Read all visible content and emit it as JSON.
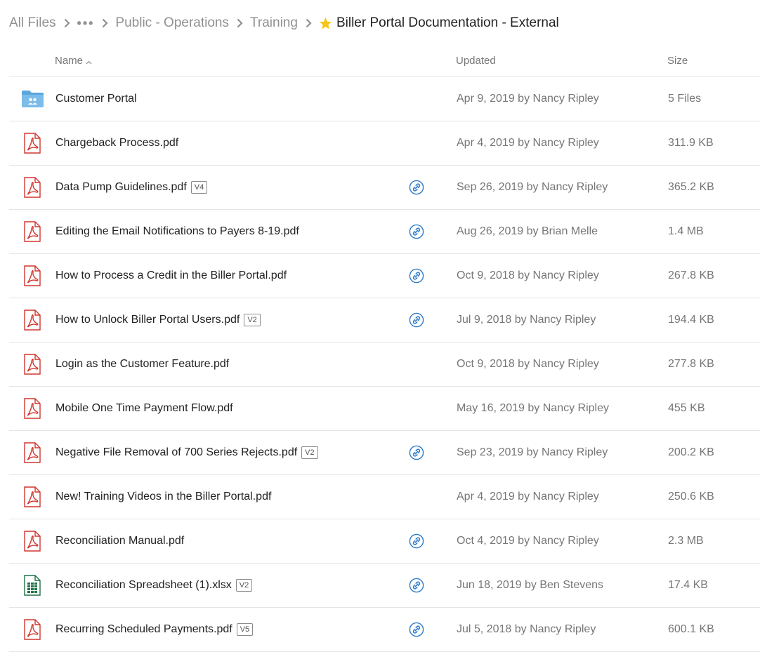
{
  "breadcrumb": {
    "items": [
      "All Files",
      "Public - Operations",
      "Training"
    ],
    "ellipsis": "•••",
    "current": "Biller Portal Documentation - External"
  },
  "columns": {
    "name": "Name",
    "updated": "Updated",
    "size": "Size"
  },
  "colors": {
    "pdf": "#d0362f",
    "folder": "#6fb3e6",
    "xlsx": "#1e7145",
    "link": "#2a79c9",
    "star": "#f5c518"
  },
  "rows": [
    {
      "type": "folder",
      "name": "Customer Portal",
      "version": "",
      "shared_link": false,
      "updated": "Apr 9, 2019 by Nancy Ripley",
      "size": "5 Files"
    },
    {
      "type": "pdf",
      "name": "Chargeback Process.pdf",
      "version": "",
      "shared_link": false,
      "updated": "Apr 4, 2019 by Nancy Ripley",
      "size": "311.9 KB"
    },
    {
      "type": "pdf",
      "name": "Data Pump Guidelines.pdf",
      "version": "V4",
      "shared_link": true,
      "updated": "Sep 26, 2019 by Nancy Ripley",
      "size": "365.2 KB"
    },
    {
      "type": "pdf",
      "name": "Editing the Email Notifications to Payers 8-19.pdf",
      "version": "",
      "shared_link": true,
      "updated": "Aug 26, 2019 by Brian Melle",
      "size": "1.4 MB"
    },
    {
      "type": "pdf",
      "name": "How to Process a Credit in the Biller Portal.pdf",
      "version": "",
      "shared_link": true,
      "updated": "Oct 9, 2018 by Nancy Ripley",
      "size": "267.8 KB"
    },
    {
      "type": "pdf",
      "name": "How to Unlock Biller Portal Users.pdf",
      "version": "V2",
      "shared_link": true,
      "updated": "Jul 9, 2018 by Nancy Ripley",
      "size": "194.4 KB"
    },
    {
      "type": "pdf",
      "name": "Login as the Customer Feature.pdf",
      "version": "",
      "shared_link": false,
      "updated": "Oct 9, 2018 by Nancy Ripley",
      "size": "277.8 KB"
    },
    {
      "type": "pdf",
      "name": "Mobile One Time Payment Flow.pdf",
      "version": "",
      "shared_link": false,
      "updated": "May 16, 2019 by Nancy Ripley",
      "size": "455 KB"
    },
    {
      "type": "pdf",
      "name": "Negative File Removal of 700 Series Rejects.pdf",
      "version": "V2",
      "shared_link": true,
      "updated": "Sep 23, 2019 by Nancy Ripley",
      "size": "200.2 KB"
    },
    {
      "type": "pdf",
      "name": "New! Training Videos in the Biller Portal.pdf",
      "version": "",
      "shared_link": false,
      "updated": "Apr 4, 2019 by Nancy Ripley",
      "size": "250.6 KB"
    },
    {
      "type": "pdf",
      "name": "Reconciliation Manual.pdf",
      "version": "",
      "shared_link": true,
      "updated": "Oct 4, 2019 by Nancy Ripley",
      "size": "2.3 MB"
    },
    {
      "type": "xlsx",
      "name": "Reconciliation Spreadsheet (1).xlsx",
      "version": "V2",
      "shared_link": true,
      "updated": "Jun 18, 2019 by Ben Stevens",
      "size": "17.4 KB"
    },
    {
      "type": "pdf",
      "name": "Recurring Scheduled Payments.pdf",
      "version": "V5",
      "shared_link": true,
      "updated": "Jul 5, 2018 by Nancy Ripley",
      "size": "600.1 KB"
    }
  ]
}
